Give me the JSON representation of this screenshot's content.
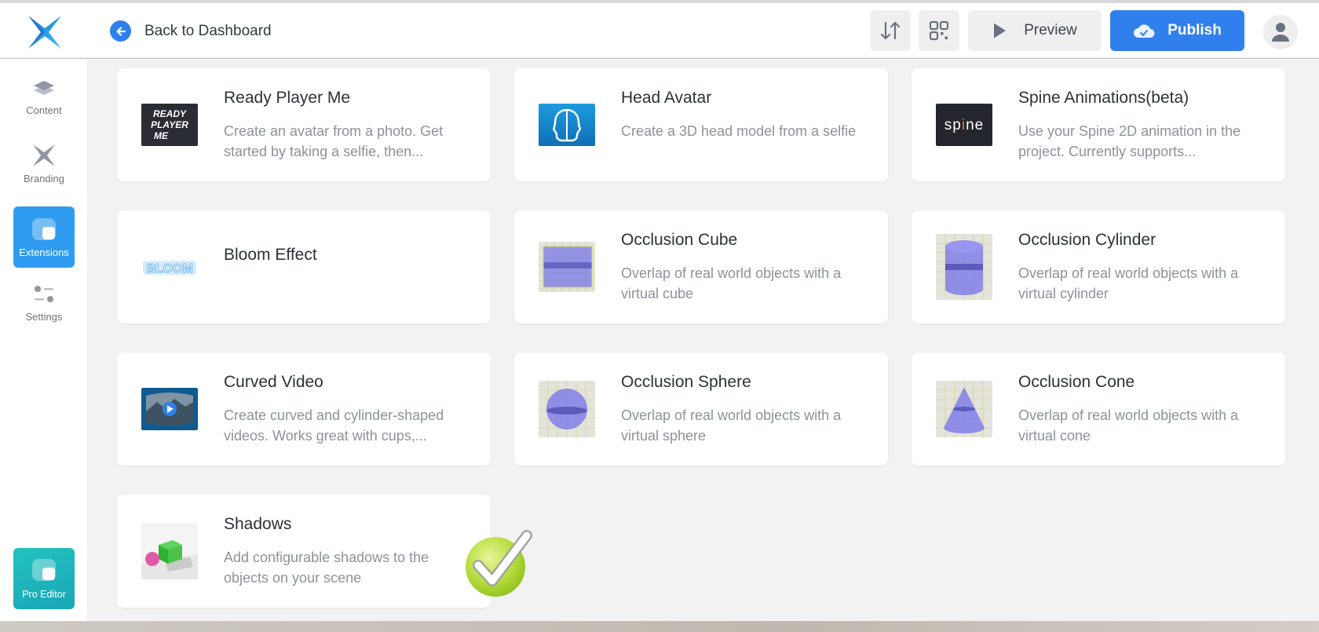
{
  "header": {
    "back_label": "Back to Dashboard",
    "preview_label": "Preview",
    "publish_label": "Publish",
    "icons": {
      "logo": "x-logo-icon",
      "back": "arrow-left-icon",
      "sort": "sort-arrows-icon",
      "qr": "qr-code-icon",
      "preview": "play-icon",
      "publish": "cloud-check-icon",
      "avatar": "user-icon"
    }
  },
  "sidebar": {
    "items": [
      {
        "label": "Content",
        "icon": "layers-icon"
      },
      {
        "label": "Branding",
        "icon": "x-logo-icon"
      },
      {
        "label": "Extensions",
        "icon": "extension-icon",
        "active": true
      },
      {
        "label": "Settings",
        "icon": "sliders-icon"
      }
    ],
    "pro_editor_label": "Pro Editor"
  },
  "extensions": [
    {
      "title": "Ready Player Me",
      "description": "Create an avatar from a photo. Get started by taking a selfie, then...",
      "thumb": "ready-player-me"
    },
    {
      "title": "Head Avatar",
      "description": "Create a 3D head model from a selfie",
      "thumb": "head-avatar"
    },
    {
      "title": "Spine Animations(beta)",
      "description": "Use your Spine 2D animation in the project. Currently supports...",
      "thumb": "spine"
    },
    {
      "title": "Bloom Effect",
      "description": "",
      "thumb": "bloom"
    },
    {
      "title": "Occlusion Cube",
      "description": "Overlap of real world objects with a virtual cube",
      "thumb": "occlusion-cube"
    },
    {
      "title": "Occlusion Cylinder",
      "description": "Overlap of real world objects with a virtual cylinder",
      "thumb": "occlusion-cylinder"
    },
    {
      "title": "Curved Video",
      "description": "Create curved and cylinder-shaped videos. Works great with cups,...",
      "thumb": "curved-video"
    },
    {
      "title": "Occlusion Sphere",
      "description": "Overlap of real world objects with a virtual sphere",
      "thumb": "occlusion-sphere"
    },
    {
      "title": "Occlusion Cone",
      "description": "Overlap of real world objects with a virtual cone",
      "thumb": "occlusion-cone"
    },
    {
      "title": "Shadows",
      "description": "Add configurable shadows to the objects on your scene",
      "thumb": "shadows"
    }
  ],
  "thumb_text": {
    "ready_player_me": "READY PLAYER ME",
    "spine": "spine",
    "bloom": "BLOOM"
  },
  "colors": {
    "accent": "#2f80ed",
    "active_tab": "#2f9cf2",
    "pro_editor": "#1fb6bc",
    "checkmark": "#9acd32"
  }
}
